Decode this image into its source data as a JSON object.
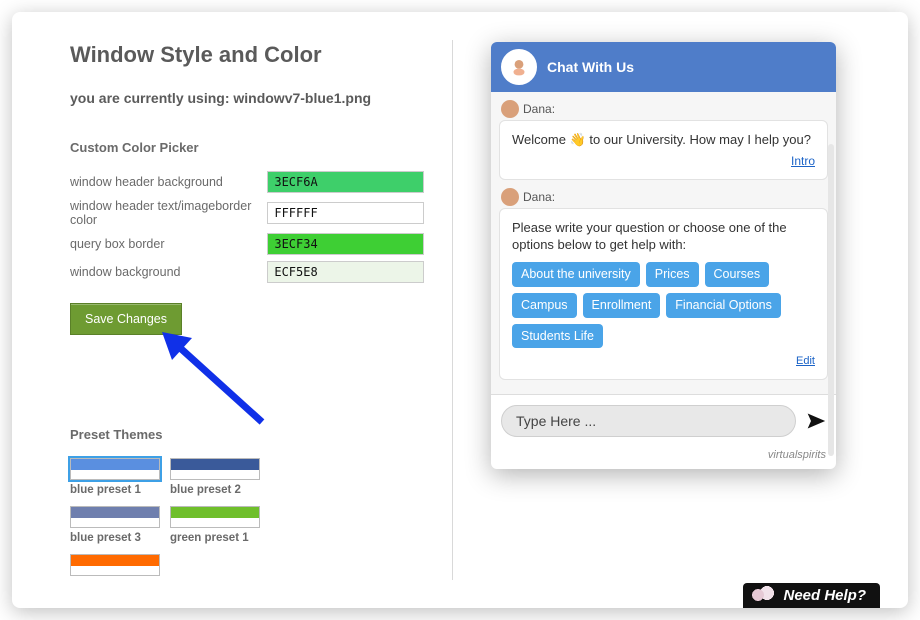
{
  "header": {
    "title": "Window Style and Color"
  },
  "subtitle_prefix": "you are currently using: ",
  "subtitle_file": "windowv7-blue1.png",
  "picker": {
    "section": "Custom Color Picker",
    "rows": [
      {
        "label": "window header background",
        "value": "3ECF6A",
        "bg": "#3ecf6a",
        "fg": "#111"
      },
      {
        "label": "window header text/imageborder color",
        "value": "FFFFFF",
        "bg": "#ffffff",
        "fg": "#111"
      },
      {
        "label": "query box border",
        "value": "3ECF34",
        "bg": "#3ecf34",
        "fg": "#111"
      },
      {
        "label": "window background",
        "value": "ECF5E8",
        "bg": "#ecf5e8",
        "fg": "#111"
      }
    ],
    "save": "Save Changes"
  },
  "presets": {
    "section": "Preset Themes",
    "items": [
      {
        "label": "blue preset 1",
        "bar": "#5a8fe0",
        "selected": true
      },
      {
        "label": "blue preset 2",
        "bar": "#3a5a9a",
        "selected": false
      },
      {
        "label": "blue preset 3",
        "bar": "#6f7fae",
        "selected": false
      },
      {
        "label": "green preset 1",
        "bar": "#6fbf2b",
        "selected": false
      },
      {
        "label": "",
        "bar": "#ff6a00",
        "selected": false
      }
    ]
  },
  "chat": {
    "title": "Chat With Us",
    "agent": "Dana:",
    "msg1": "Welcome 👋 to our University. How may I help you?",
    "intro": "Intro",
    "msg2": "Please write your question or choose one of the options below to get help with:",
    "chips": [
      "About the university",
      "Prices",
      "Courses",
      "Campus",
      "Enrollment",
      "Financial Options",
      "Students Life"
    ],
    "edit": "Edit",
    "placeholder": "Type Here ...",
    "brand": "virtualspirits"
  },
  "needhelp": "Need Help?"
}
